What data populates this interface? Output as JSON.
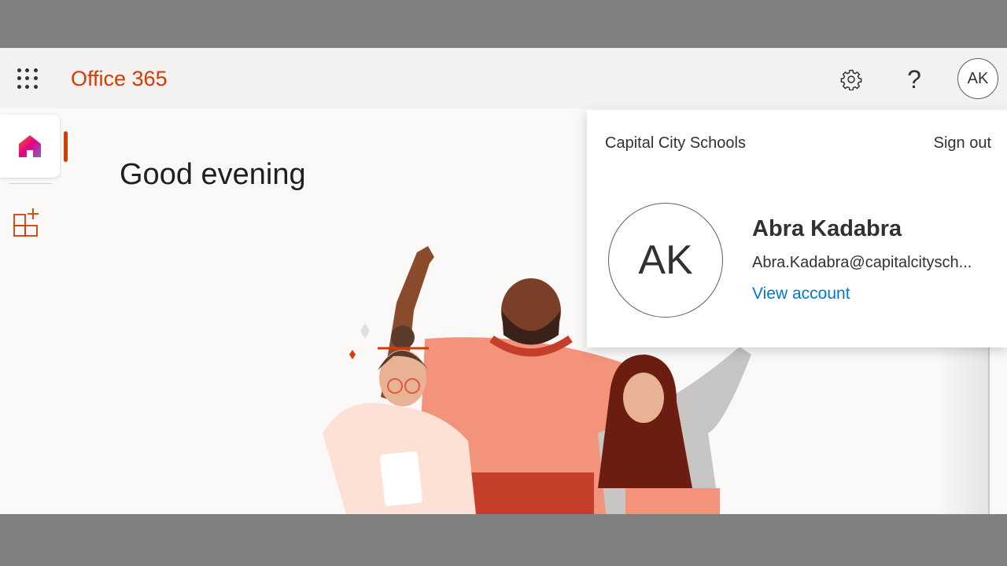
{
  "header": {
    "brand": "Office 365",
    "help_label": "?",
    "avatar_initials": "AK",
    "icons": [
      "app-launcher-icon",
      "gear-icon"
    ]
  },
  "rail": {
    "items": [
      {
        "name": "home",
        "icon": "home-icon",
        "selected": true
      },
      {
        "name": "create",
        "icon": "apps-add-icon",
        "selected": false
      }
    ]
  },
  "main": {
    "greeting": "Good evening"
  },
  "account_panel": {
    "org": "Capital City Schools",
    "sign_out": "Sign out",
    "initials": "AK",
    "name": "Abra Kadabra",
    "email": "Abra.Kadabra@capitalcitysch...",
    "view_account": "View account"
  },
  "colors": {
    "brand": "#d83b01",
    "link": "#0078d4",
    "header_bg": "#f3f2f1",
    "page_bg": "#faf9f8"
  }
}
